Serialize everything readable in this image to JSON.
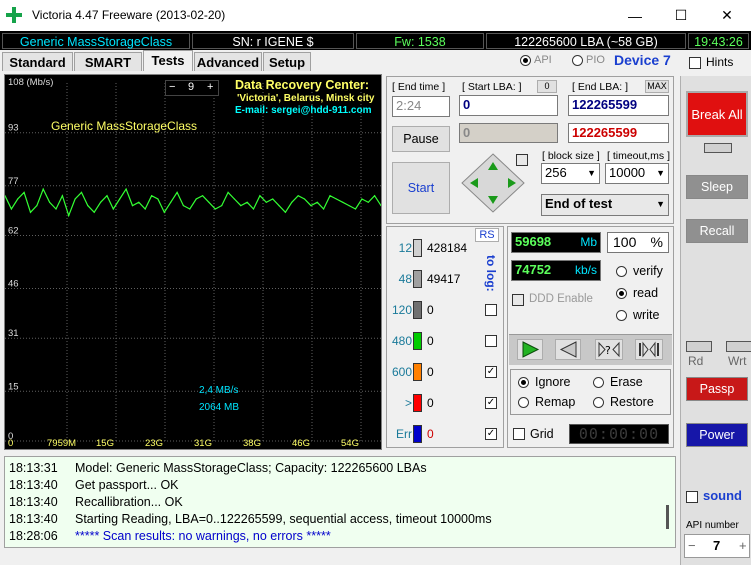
{
  "window": {
    "title": "Victoria 4.47  Freeware (2013-02-20)",
    "minimize": "—",
    "maximize": "☐",
    "close": "✕"
  },
  "info": {
    "model": "Generic MassStorageClass",
    "serial": "SN: r IGENE $",
    "firmware": "Fw: 1538",
    "capacity": "122265600 LBA (~58 GB)",
    "clock": "19:43:26"
  },
  "mode": {
    "api": "API",
    "pio": "PIO",
    "device": "Device 7",
    "hints": "Hints"
  },
  "tabs": [
    "Standard",
    "SMART",
    "Tests",
    "Advanced",
    "Setup"
  ],
  "graph": {
    "unit": "108 (Mb/s)",
    "y_ticks": [
      "93",
      "77",
      "62",
      "46",
      "31",
      "15",
      "0"
    ],
    "x_ticks": [
      "7959M",
      "15G",
      "23G",
      "31G",
      "38G",
      "46G",
      "54G"
    ],
    "scale_value": "9",
    "drive_label": "Generic MassStorageClass",
    "speed": "2,4 MB/s",
    "position": "2064 MB",
    "banner": {
      "line1": "Data Recovery Center:",
      "line2": "'Victoria', Belarus, Minsk city",
      "line3": "E-mail: sergei@hdd-911.com"
    },
    "colors": {
      "trace": "#33ff33",
      "background": "#000000",
      "grid": "#606060"
    }
  },
  "chart_data": {
    "type": "line",
    "title": "",
    "ylabel": "108 (Mb/s)",
    "xlabel": "",
    "ylim": [
      0,
      108
    ],
    "y_ticks": [
      93,
      77,
      62,
      46,
      31,
      15,
      0
    ],
    "x_tick_labels": [
      "7959M",
      "15G",
      "23G",
      "31G",
      "38G",
      "46G",
      "54G"
    ],
    "series": [
      {
        "values": [
          74,
          70,
          73,
          75,
          69,
          71,
          76,
          72,
          70,
          74,
          68,
          73,
          75,
          71,
          69,
          72,
          74,
          70,
          73,
          76,
          71,
          72,
          70,
          74,
          73,
          69,
          72,
          75,
          71,
          70,
          73,
          74,
          72,
          70,
          71,
          75,
          73,
          71,
          72,
          70,
          74,
          72,
          73,
          71,
          69,
          72,
          74,
          73,
          71,
          72,
          70,
          74,
          73,
          72,
          71,
          70,
          73,
          72,
          74,
          71
        ]
      }
    ],
    "grid": true
  },
  "controls": {
    "end_time_label": "[ End time ]",
    "end_time_value": "2:24",
    "start_lba_label": "[ Start LBA: ]",
    "start_lba_extra": "0",
    "start_lba_value": "0",
    "start_lba_current": "0",
    "end_lba_label": "[ End LBA: ]",
    "end_lba_max": "MAX",
    "end_lba_value": "122265599",
    "end_lba_current": "122265599",
    "pause": "Pause",
    "start": "Start",
    "block_size_label": "[ block size ]",
    "block_size_value": "256",
    "timeout_label": "[ timeout,ms ]",
    "timeout_value": "10000",
    "end_action": "End of test"
  },
  "stats": {
    "rs": "RS",
    "to_log": "to log:",
    "rows": [
      {
        "label": "12",
        "value": "428184",
        "color": "#d0d0d0"
      },
      {
        "label": "48",
        "value": "49417",
        "color": "#a0a0a0"
      },
      {
        "label": "120",
        "value": "0",
        "color": "#707070"
      },
      {
        "label": "480",
        "value": "0",
        "color": "#00cc00"
      },
      {
        "label": "600",
        "value": "0",
        "color": "#ff8000"
      },
      {
        "label": ">",
        "value": "0",
        "color": "#ff0000"
      },
      {
        "label": "Err",
        "value": "0",
        "color": "#0000cc"
      }
    ]
  },
  "progress": {
    "mb_value": "59698",
    "mb_unit": "Mb",
    "percent": "100",
    "percent_unit": "%",
    "kbs_value": "74752",
    "kbs_unit": "kb/s",
    "ddd": "DDD Enable",
    "verify": "verify",
    "read": "read",
    "write": "write",
    "ignore": "Ignore",
    "erase": "Erase",
    "remap": "Remap",
    "restore": "Restore",
    "grid": "Grid",
    "timer": "00:00:00"
  },
  "right": {
    "break_all": "Break All",
    "sleep": "Sleep",
    "recall": "Recall",
    "rd": "Rd",
    "wrt": "Wrt",
    "passp": "Passp",
    "power": "Power",
    "sound": "sound",
    "api_number_label": "API number",
    "api_minus": "−",
    "api_value": "7",
    "api_plus": "+"
  },
  "log": [
    {
      "time": "18:13:31",
      "text": "Model: Generic MassStorageClass; Capacity: 122265600 LBAs",
      "color": "#000000"
    },
    {
      "time": "18:13:40",
      "text": "Get passport... OK",
      "color": "#000000"
    },
    {
      "time": "18:13:40",
      "text": "Recallibration... OK",
      "color": "#000000"
    },
    {
      "time": "18:13:40",
      "text": "Starting Reading, LBA=0..122265599, sequential access, timeout 10000ms",
      "color": "#000000"
    },
    {
      "time": "18:28:06",
      "text": "***** Scan results: no warnings, no errors *****",
      "color": "#0000cc"
    }
  ]
}
